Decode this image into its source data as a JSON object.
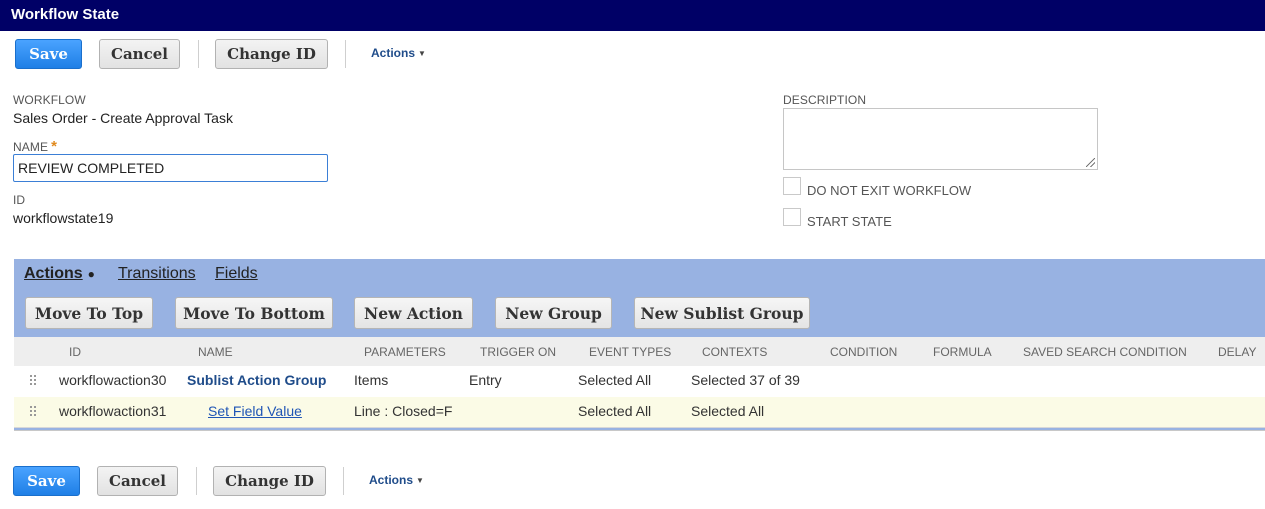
{
  "window": {
    "title": "Workflow State"
  },
  "toolbar": {
    "save_label": "Save",
    "cancel_label": "Cancel",
    "change_id_label": "Change ID",
    "actions_label": "Actions"
  },
  "form": {
    "workflow_label": "WORKFLOW",
    "workflow_value": "Sales Order - Create Approval Task",
    "name_label": "NAME",
    "name_required_marker": "*",
    "name_value": "REVIEW COMPLETED",
    "id_label": "ID",
    "id_value": "workflowstate19",
    "description_label": "DESCRIPTION",
    "description_value": "",
    "do_not_exit_label": "DO NOT EXIT WORKFLOW",
    "do_not_exit_checked": false,
    "start_state_label": "START STATE",
    "start_state_checked": false
  },
  "subtabs": {
    "items": [
      "Actions",
      "Transitions",
      "Fields"
    ],
    "active": "Actions",
    "active_marker": "●"
  },
  "sublist_buttons": {
    "move_to_top": "Move To Top",
    "move_to_bottom": "Move To Bottom",
    "new_action": "New Action",
    "new_group": "New Group",
    "new_sublist_group": "New Sublist Group"
  },
  "table": {
    "columns": [
      "ID",
      "NAME",
      "PARAMETERS",
      "TRIGGER ON",
      "EVENT TYPES",
      "CONTEXTS",
      "CONDITION",
      "FORMULA",
      "SAVED SEARCH CONDITION",
      "DELAY"
    ],
    "rows": [
      {
        "id": "workflowaction30",
        "name": "Sublist Action Group",
        "parameters": "Items",
        "trigger_on": "Entry",
        "event_types": "Selected All",
        "contexts": "Selected 37 of 39",
        "condition": "",
        "formula": "",
        "saved_search_condition": "",
        "delay": ""
      },
      {
        "id": "workflowaction31",
        "name": "Set Field Value",
        "parameters": "Line : Closed=F",
        "trigger_on": "",
        "event_types": "Selected All",
        "contexts": "Selected All",
        "condition": "",
        "formula": "",
        "saved_search_condition": "",
        "delay": ""
      }
    ]
  },
  "colors": {
    "title_bar": "#000066",
    "primary_button": "#2b8cf0",
    "subtab_band": "#98b2e2",
    "selected_row": "#fbfbe6",
    "link": "#1f4c8a"
  }
}
